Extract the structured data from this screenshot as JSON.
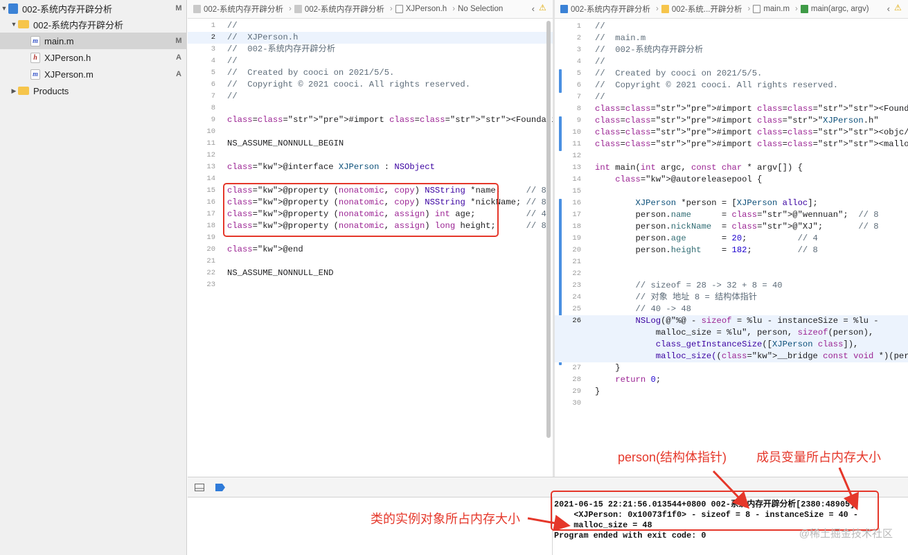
{
  "navigator": {
    "rows": [
      {
        "label": "002-系统内存开辟分析",
        "badge": "M"
      },
      {
        "label": "002-系统内存开辟分析",
        "badge": ""
      },
      {
        "label": "main.m",
        "badge": "M"
      },
      {
        "label": "XJPerson.h",
        "badge": "A"
      },
      {
        "label": "XJPerson.m",
        "badge": "A"
      },
      {
        "label": "Products",
        "badge": ""
      }
    ]
  },
  "left_editor": {
    "jumpbar": [
      "002-系统内存开辟分析",
      "002-系统内存开辟分析",
      "XJPerson.h",
      "No Selection"
    ],
    "lines": [
      {
        "n": "1",
        "t": "//"
      },
      {
        "n": "2",
        "t": "//  XJPerson.h"
      },
      {
        "n": "3",
        "t": "//  002-系统内存开辟分析"
      },
      {
        "n": "4",
        "t": "//"
      },
      {
        "n": "5",
        "t": "//  Created by cooci on 2021/5/5."
      },
      {
        "n": "6",
        "t": "//  Copyright © 2021 cooci. All rights reserved."
      },
      {
        "n": "7",
        "t": "//"
      },
      {
        "n": "8",
        "t": ""
      },
      {
        "n": "9",
        "t": "#import <Foundation/Foundation.h>"
      },
      {
        "n": "10",
        "t": ""
      },
      {
        "n": "11",
        "t": "NS_ASSUME_NONNULL_BEGIN"
      },
      {
        "n": "12",
        "t": ""
      },
      {
        "n": "13",
        "t": "@interface XJPerson : NSObject"
      },
      {
        "n": "14",
        "t": ""
      },
      {
        "n": "15",
        "t": "@property (nonatomic, copy) NSString *name;     // 8"
      },
      {
        "n": "16",
        "t": "@property (nonatomic, copy) NSString *nickName; // 8"
      },
      {
        "n": "17",
        "t": "@property (nonatomic, assign) int age;          // 4"
      },
      {
        "n": "18",
        "t": "@property (nonatomic, assign) long height;      // 8"
      },
      {
        "n": "19",
        "t": ""
      },
      {
        "n": "20",
        "t": "@end"
      },
      {
        "n": "21",
        "t": ""
      },
      {
        "n": "22",
        "t": "NS_ASSUME_NONNULL_END"
      },
      {
        "n": "23",
        "t": ""
      }
    ]
  },
  "right_editor": {
    "jumpbar": [
      "002-系统内存开辟分析",
      "002-系统...开辟分析",
      "main.m",
      "main(argc, argv)"
    ],
    "lines": [
      {
        "n": "1",
        "t": "//"
      },
      {
        "n": "2",
        "t": "//  main.m"
      },
      {
        "n": "3",
        "t": "//  002-系统内存开辟分析"
      },
      {
        "n": "4",
        "t": "//"
      },
      {
        "n": "5",
        "t": "//  Created by cooci on 2021/5/5."
      },
      {
        "n": "6",
        "t": "//  Copyright © 2021 cooci. All rights reserved."
      },
      {
        "n": "7",
        "t": "//"
      },
      {
        "n": "8",
        "t": "#import <Foundation/Foundation.h>"
      },
      {
        "n": "9",
        "t": "#import \"XJPerson.h\""
      },
      {
        "n": "10",
        "t": "#import <objc/runtime.h>"
      },
      {
        "n": "11",
        "t": "#import <malloc/malloc.h>"
      },
      {
        "n": "12",
        "t": ""
      },
      {
        "n": "13",
        "t": "int main(int argc, const char * argv[]) {"
      },
      {
        "n": "14",
        "t": "    @autoreleasepool {"
      },
      {
        "n": "15",
        "t": ""
      },
      {
        "n": "16",
        "t": "        XJPerson *person = [XJPerson alloc];"
      },
      {
        "n": "17",
        "t": "        person.name      = @\"wennuan\";  // 8"
      },
      {
        "n": "18",
        "t": "        person.nickName  = @\"XJ\";       // 8"
      },
      {
        "n": "19",
        "t": "        person.age       = 20;          // 4"
      },
      {
        "n": "20",
        "t": "        person.height    = 182;         // 8"
      },
      {
        "n": "21",
        "t": ""
      },
      {
        "n": "22",
        "t": ""
      },
      {
        "n": "23",
        "t": "        // sizeof = 28 -> 32 + 8 = 40"
      },
      {
        "n": "24",
        "t": "        // 对象 地址 8 = 结构体指针"
      },
      {
        "n": "25",
        "t": "        // 40 -> 48"
      },
      {
        "n": "26",
        "t": "        NSLog(@\"%@ - sizeof = %lu - instanceSize = %lu -"
      },
      {
        "n": "",
        "t": "            malloc_size = %lu\", person, sizeof(person),"
      },
      {
        "n": "",
        "t": "            class_getInstanceSize([XJPerson class]),"
      },
      {
        "n": "",
        "t": "            malloc_size((__bridge const void *)(person)));"
      },
      {
        "n": "27",
        "t": "    }"
      },
      {
        "n": "28",
        "t": "    return 0;"
      },
      {
        "n": "29",
        "t": "}"
      },
      {
        "n": "30",
        "t": ""
      }
    ]
  },
  "console": {
    "lines": [
      "2021-06-15 22:21:56.013544+0800 002-系统内存开辟分析[2380:48905]",
      "    <XJPerson: 0x10073f1f0> - sizeof = 8 - instanceSize = 40 -",
      "    malloc_size = 48",
      "Program ended with exit code: 0"
    ]
  },
  "annotations": {
    "person_pointer": "person(结构体指针)",
    "ivar_memory": "成员变量所占内存大小",
    "instance_memory": "类的实例对象所占内存大小"
  },
  "watermark": "@稀土掘金技术社区",
  "colors": {
    "annotation": "#e5372a",
    "accent": "#4a90e2"
  }
}
